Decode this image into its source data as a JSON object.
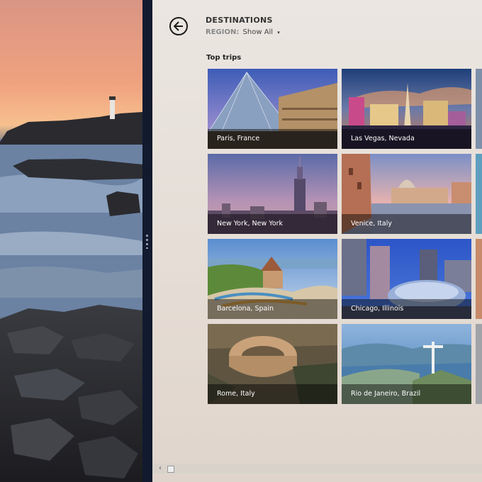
{
  "header": {
    "title": "DESTINATIONS",
    "region_label": "REGION:",
    "region_value": "Show All",
    "region_caret": "▾"
  },
  "section": {
    "title": "Top trips"
  },
  "tiles": [
    {
      "label": "Paris, France"
    },
    {
      "label": "Las Vegas, Nevada"
    },
    {
      "label": "New York, New York"
    },
    {
      "label": "Venice, Italy"
    },
    {
      "label": "Barcelona, Spain"
    },
    {
      "label": "Chicago, Illinois"
    },
    {
      "label": "Rome, Italy"
    },
    {
      "label": "Rio de Janeiro, Brazil"
    }
  ],
  "scrollbar": {
    "left_arrow": "‹"
  },
  "icons": {
    "back": "back-arrow-icon",
    "divider": "drag-handle-icon"
  }
}
